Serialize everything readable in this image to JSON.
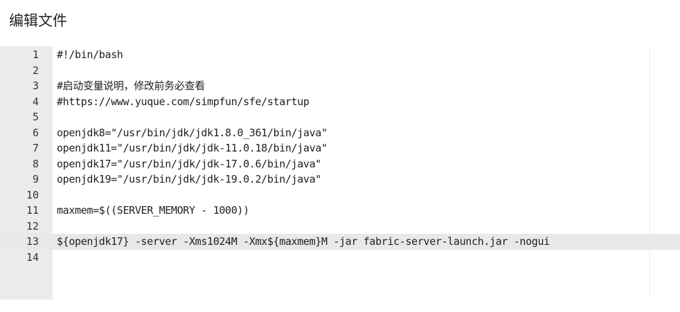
{
  "page": {
    "title": "编辑文件"
  },
  "editor": {
    "active_line": 13,
    "lines": [
      {
        "number": "1",
        "text": "#!/bin/bash"
      },
      {
        "number": "2",
        "text": ""
      },
      {
        "number": "3",
        "text": "#启动变量说明，修改前务必查看"
      },
      {
        "number": "4",
        "text": "#https://www.yuque.com/simpfun/sfe/startup"
      },
      {
        "number": "5",
        "text": ""
      },
      {
        "number": "6",
        "text": "openjdk8=\"/usr/bin/jdk/jdk1.8.0_361/bin/java\""
      },
      {
        "number": "7",
        "text": "openjdk11=\"/usr/bin/jdk/jdk-11.0.18/bin/java\""
      },
      {
        "number": "8",
        "text": "openjdk17=\"/usr/bin/jdk/jdk-17.0.6/bin/java\""
      },
      {
        "number": "9",
        "text": "openjdk19=\"/usr/bin/jdk/jdk-19.0.2/bin/java\""
      },
      {
        "number": "10",
        "text": ""
      },
      {
        "number": "11",
        "text": "maxmem=$((SERVER_MEMORY - 1000))"
      },
      {
        "number": "12",
        "text": ""
      },
      {
        "number": "13",
        "text": "${openjdk17} -server -Xms1024M -Xmx${maxmem}M -jar fabric-server-launch.jar -nogui"
      },
      {
        "number": "14",
        "text": ""
      }
    ]
  }
}
